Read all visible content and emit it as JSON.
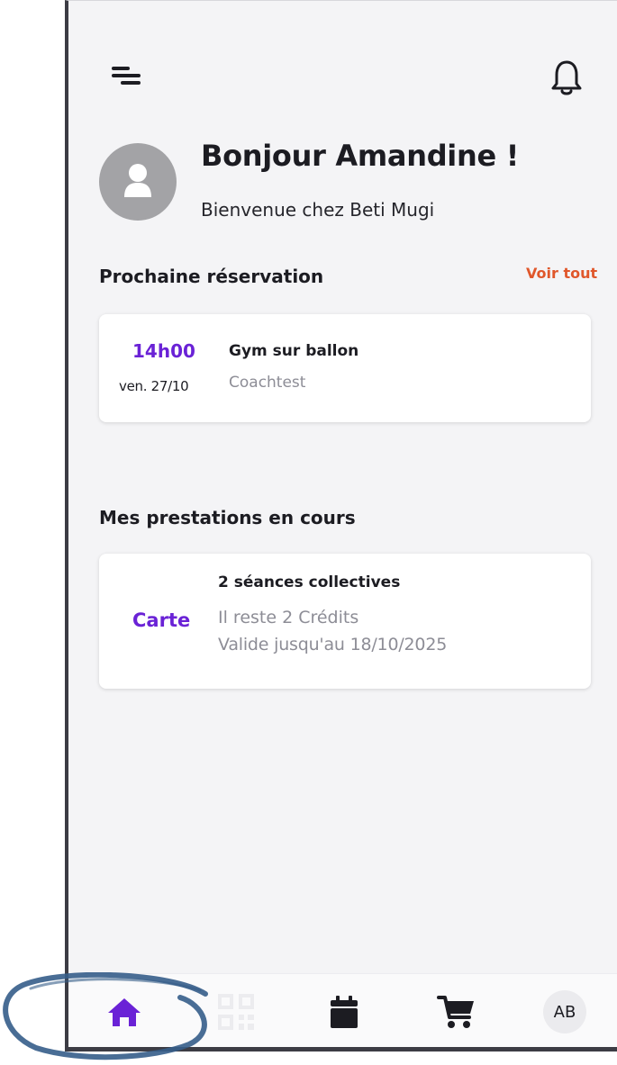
{
  "colors": {
    "accent": "#6a22d6",
    "link": "#e0572b",
    "text": "#1c1c22",
    "muted": "#8d8d96",
    "background": "#f4f4f6"
  },
  "header": {
    "menu_icon": "menu-icon",
    "notification_icon": "bell-icon"
  },
  "greeting": {
    "title": "Bonjour Amandine !",
    "subtitle": "Bienvenue chez Beti Mugi",
    "avatar_icon": "user-icon"
  },
  "next_booking": {
    "section_title": "Prochaine réservation",
    "see_all_label": "Voir tout",
    "card": {
      "time": "14h00",
      "date": "ven. 27/10",
      "activity": "Gym sur ballon",
      "coach": "Coachtest"
    }
  },
  "services": {
    "section_title": "Mes prestations en cours",
    "card": {
      "type": "Carte",
      "name": "2 séances collectives",
      "credits": "Il reste 2 Crédits",
      "validity": "Valide jusqu'au 18/10/2025"
    }
  },
  "bottom_nav": {
    "items": [
      {
        "name": "home",
        "icon": "home-icon",
        "active": true
      },
      {
        "name": "qr-code",
        "icon": "qr-code-icon",
        "active": false
      },
      {
        "name": "calendar",
        "icon": "calendar-icon",
        "active": false
      },
      {
        "name": "cart",
        "icon": "cart-icon",
        "active": false
      },
      {
        "name": "profile",
        "label": "AB",
        "active": false
      }
    ]
  }
}
